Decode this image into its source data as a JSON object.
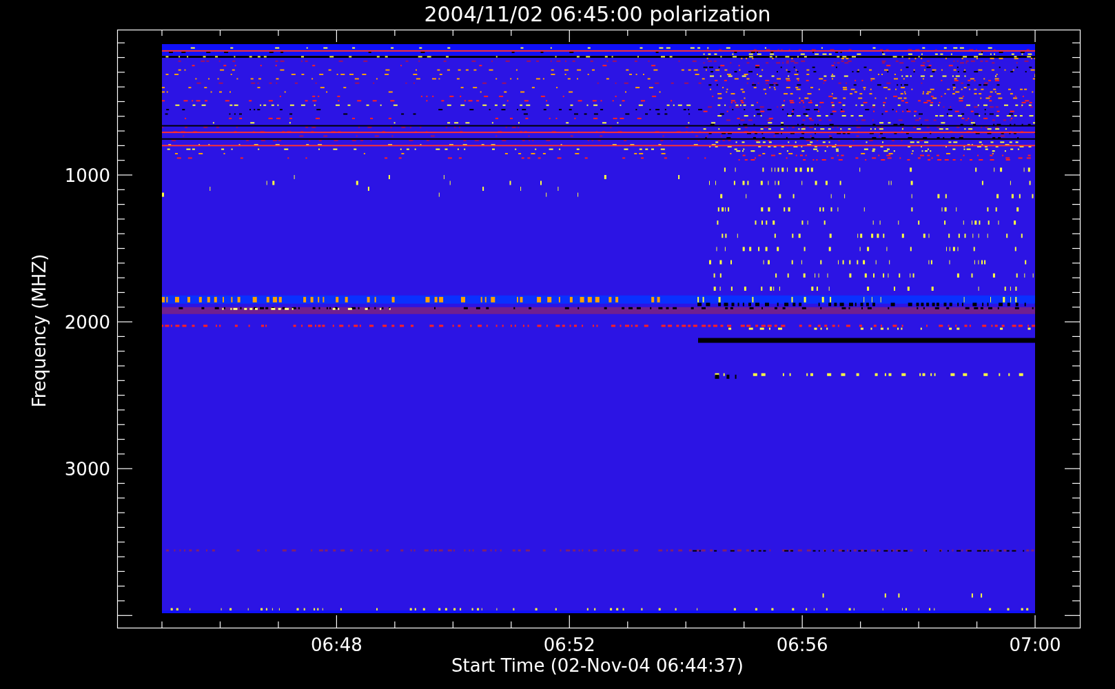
{
  "plot": {
    "title": "2004/11/02 06:45:00 polarization",
    "ylabel": "Frequency (MHZ)",
    "xlabel": "Start Time (02-Nov-04 06:44:37)",
    "y_tick_labels": [
      "1000",
      "2000",
      "3000"
    ],
    "x_tick_labels": [
      "06:48",
      "06:52",
      "06:56",
      "07:00"
    ]
  }
}
